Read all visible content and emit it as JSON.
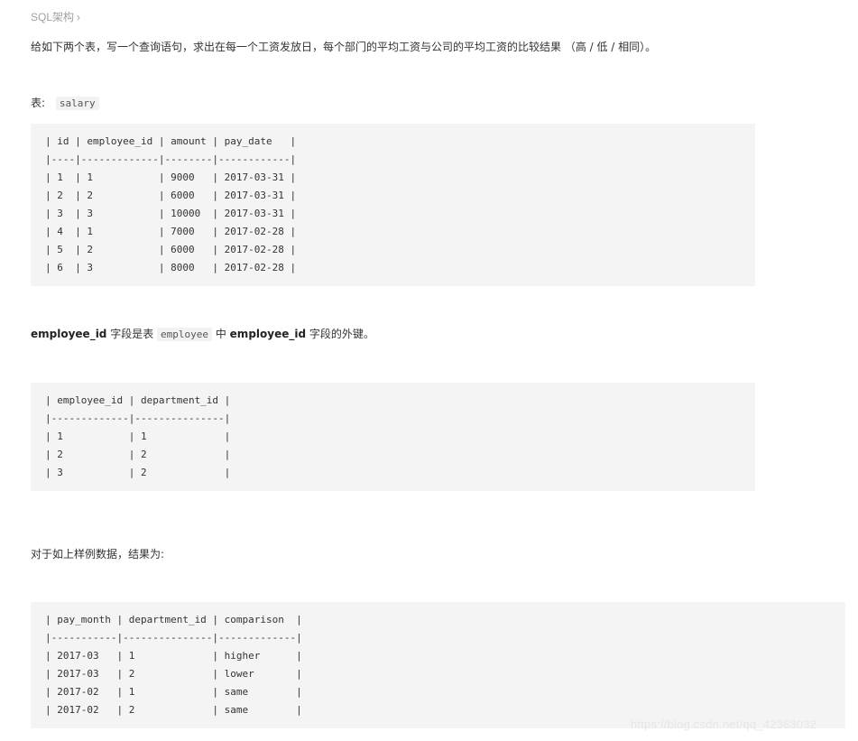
{
  "breadcrumb": {
    "label": "SQL架构",
    "chevron_icon": "chevron-right-icon"
  },
  "question": "给如下两个表，写一个查询语句，求出在每一个工资发放日，每个部门的平均工资与公司的平均工资的比较结果 （高 / 低 / 相同）。",
  "salary_label": {
    "prefix": "表:",
    "table_name": "salary"
  },
  "salary_table": "| id | employee_id | amount | pay_date   |\n|----|-------------|--------|------------|\n| 1  | 1           | 9000   | 2017-03-31 |\n| 2  | 2           | 6000   | 2017-03-31 |\n| 3  | 3           | 10000  | 2017-03-31 |\n| 4  | 1           | 7000   | 2017-02-28 |\n| 5  | 2           | 6000   | 2017-02-28 |\n| 6  | 3           | 8000   | 2017-02-28 |",
  "fk_note": {
    "field1": "employee_id",
    "text1": " 字段是表 ",
    "table": "employee",
    "text2": " 中 ",
    "field2": "employee_id",
    "text3": " 字段的外键。"
  },
  "employee_table": "| employee_id | department_id |\n|-------------|---------------|\n| 1           | 1             |\n| 2           | 2             |\n| 3           | 2             |",
  "result_intro": "对于如上样例数据，结果为:",
  "result_table": "| pay_month | department_id | comparison  |\n|-----------|---------------|-------------|\n| 2017-03   | 1             | higher      |\n| 2017-03   | 2             | lower       |\n| 2017-02   | 1             | same        |\n| 2017-02   | 2             | same        |",
  "watermark": "https://blog.csdn.net/qq_42363032"
}
